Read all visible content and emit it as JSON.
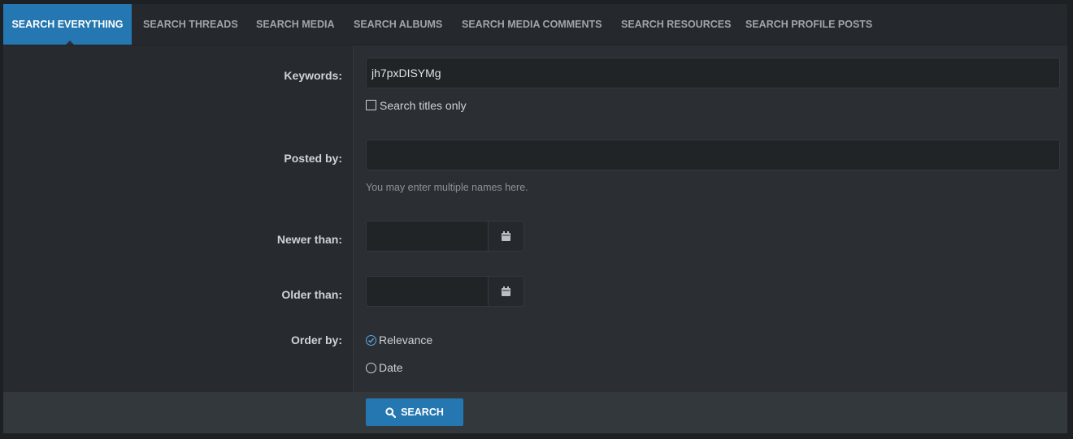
{
  "tabs": [
    {
      "label": "SEARCH EVERYTHING",
      "active": true
    },
    {
      "label": "SEARCH THREADS"
    },
    {
      "label": "SEARCH MEDIA"
    },
    {
      "label": "SEARCH ALBUMS"
    },
    {
      "label": "SEARCH MEDIA COMMENTS"
    },
    {
      "label": "SEARCH RESOURCES"
    },
    {
      "label": "SEARCH PROFILE POSTS"
    }
  ],
  "form": {
    "keywords_label": "Keywords:",
    "keywords_value": "jh7pxDISYMg",
    "titles_only_label": "Search titles only",
    "posted_by_label": "Posted by:",
    "posted_by_value": "",
    "posted_by_hint": "You may enter multiple names here.",
    "newer_than_label": "Newer than:",
    "older_than_label": "Older than:",
    "order_by_label": "Order by:",
    "order_options": [
      {
        "label": "Relevance",
        "selected": true
      },
      {
        "label": "Date",
        "selected": false
      }
    ]
  },
  "search_button": "SEARCH",
  "icons": {
    "calendar": "calendar-icon",
    "search": "magnifier-icon",
    "check": "check-icon"
  },
  "colors": {
    "accent": "#2577b1",
    "background": "#2b2f33",
    "radio_selected": "#5ea9e6"
  }
}
